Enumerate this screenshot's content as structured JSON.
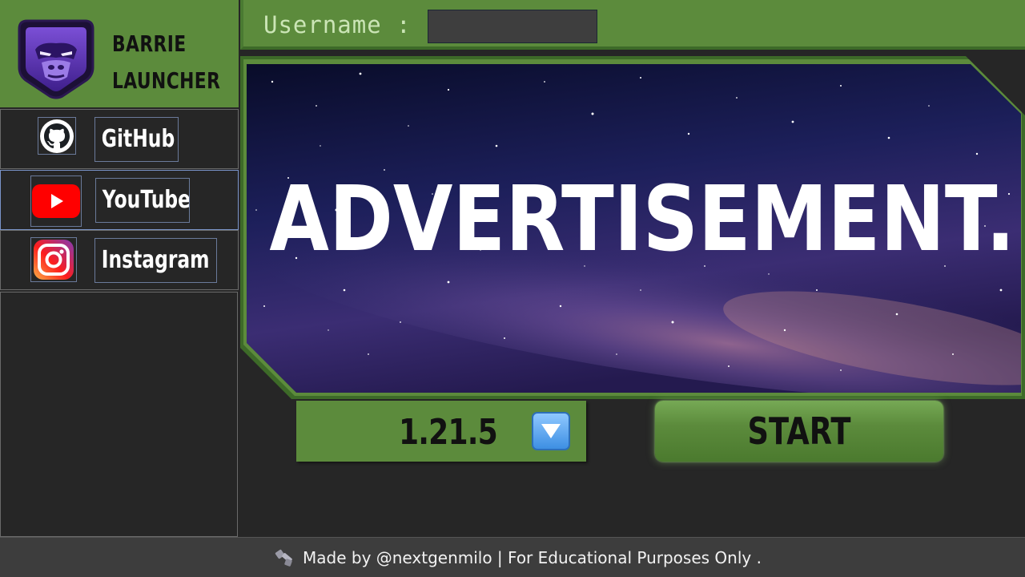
{
  "app": {
    "brand_line1": "BARRIE",
    "brand_line2": "LAUNCHER"
  },
  "sidebar": {
    "links": [
      {
        "label": "GitHub",
        "icon": "github-icon"
      },
      {
        "label": "YouTube",
        "icon": "youtube-icon"
      },
      {
        "label": "Instagram",
        "icon": "instagram-icon"
      }
    ]
  },
  "topbar": {
    "username_label": "Username :",
    "username_value": ""
  },
  "banner": {
    "text": "ADVERTISEMENT."
  },
  "version": {
    "selected": "1.21.5"
  },
  "start": {
    "label": "START"
  },
  "footer": {
    "text": "Made by @nextgenmilo | For Educational Purposes Only ."
  },
  "colors": {
    "accent_green": "#5c8b3c",
    "dark_bg": "#262626",
    "footer_bg": "#3d3d3d"
  }
}
